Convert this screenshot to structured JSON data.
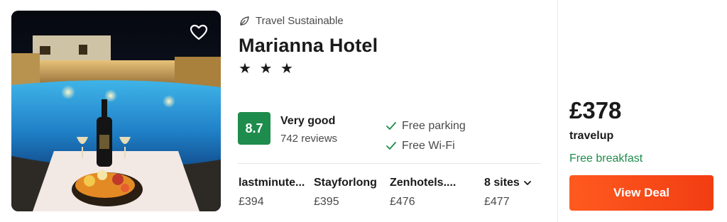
{
  "hotel": {
    "sustainable_label": "Travel Sustainable",
    "name": "Marianna Hotel",
    "stars": "★ ★ ★",
    "rating": {
      "score": "8.7",
      "label": "Very good",
      "reviews": "742 reviews",
      "badge_color": "#1e8c4c"
    },
    "amenities": [
      {
        "label": "Free parking",
        "icon": "check-icon"
      },
      {
        "label": "Free Wi-Fi",
        "icon": "check-icon"
      }
    ]
  },
  "sites": [
    {
      "name": "lastminute...",
      "price": "£394"
    },
    {
      "name": "Stayforlong",
      "price": "£395"
    },
    {
      "name": "Zenhotels....",
      "price": "£476"
    }
  ],
  "more_sites": {
    "label": "8 sites",
    "price": "£477",
    "icon": "chevron-down-icon"
  },
  "deal": {
    "price": "£378",
    "provider": "travelup",
    "note": "Free breakfast",
    "button_label": "View Deal",
    "accent_color": "#f23d12"
  },
  "icons": {
    "favorite": "heart-outline-icon",
    "sustainable": "leaf-icon"
  }
}
